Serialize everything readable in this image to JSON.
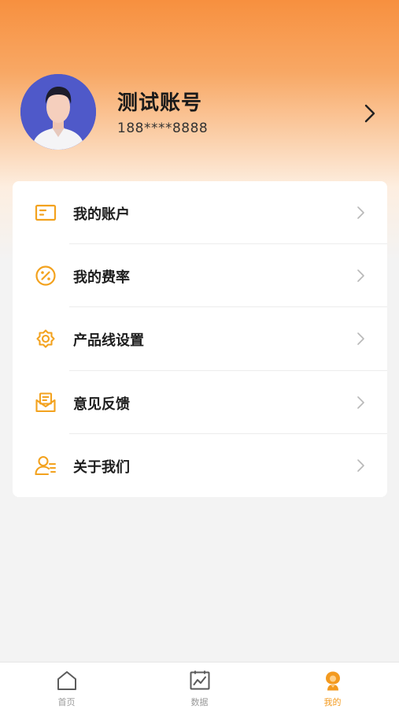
{
  "profile": {
    "name": "测试账号",
    "phone": "188****8888"
  },
  "menu": {
    "items": [
      {
        "label": "我的账户",
        "icon": "wallet-card-icon"
      },
      {
        "label": "我的费率",
        "icon": "percent-icon"
      },
      {
        "label": "产品线设置",
        "icon": "gear-icon"
      },
      {
        "label": "意见反馈",
        "icon": "feedback-mail-icon"
      },
      {
        "label": "关于我们",
        "icon": "user-info-icon"
      }
    ]
  },
  "tabbar": {
    "tabs": [
      {
        "label": "首页",
        "icon": "home-icon",
        "active": false
      },
      {
        "label": "数据",
        "icon": "chart-icon",
        "active": false
      },
      {
        "label": "我的",
        "icon": "profile-icon",
        "active": true
      }
    ]
  },
  "colors": {
    "accent": "#f39a1f",
    "header_top": "#f7903f",
    "avatar_bg": "#4f59c9"
  }
}
